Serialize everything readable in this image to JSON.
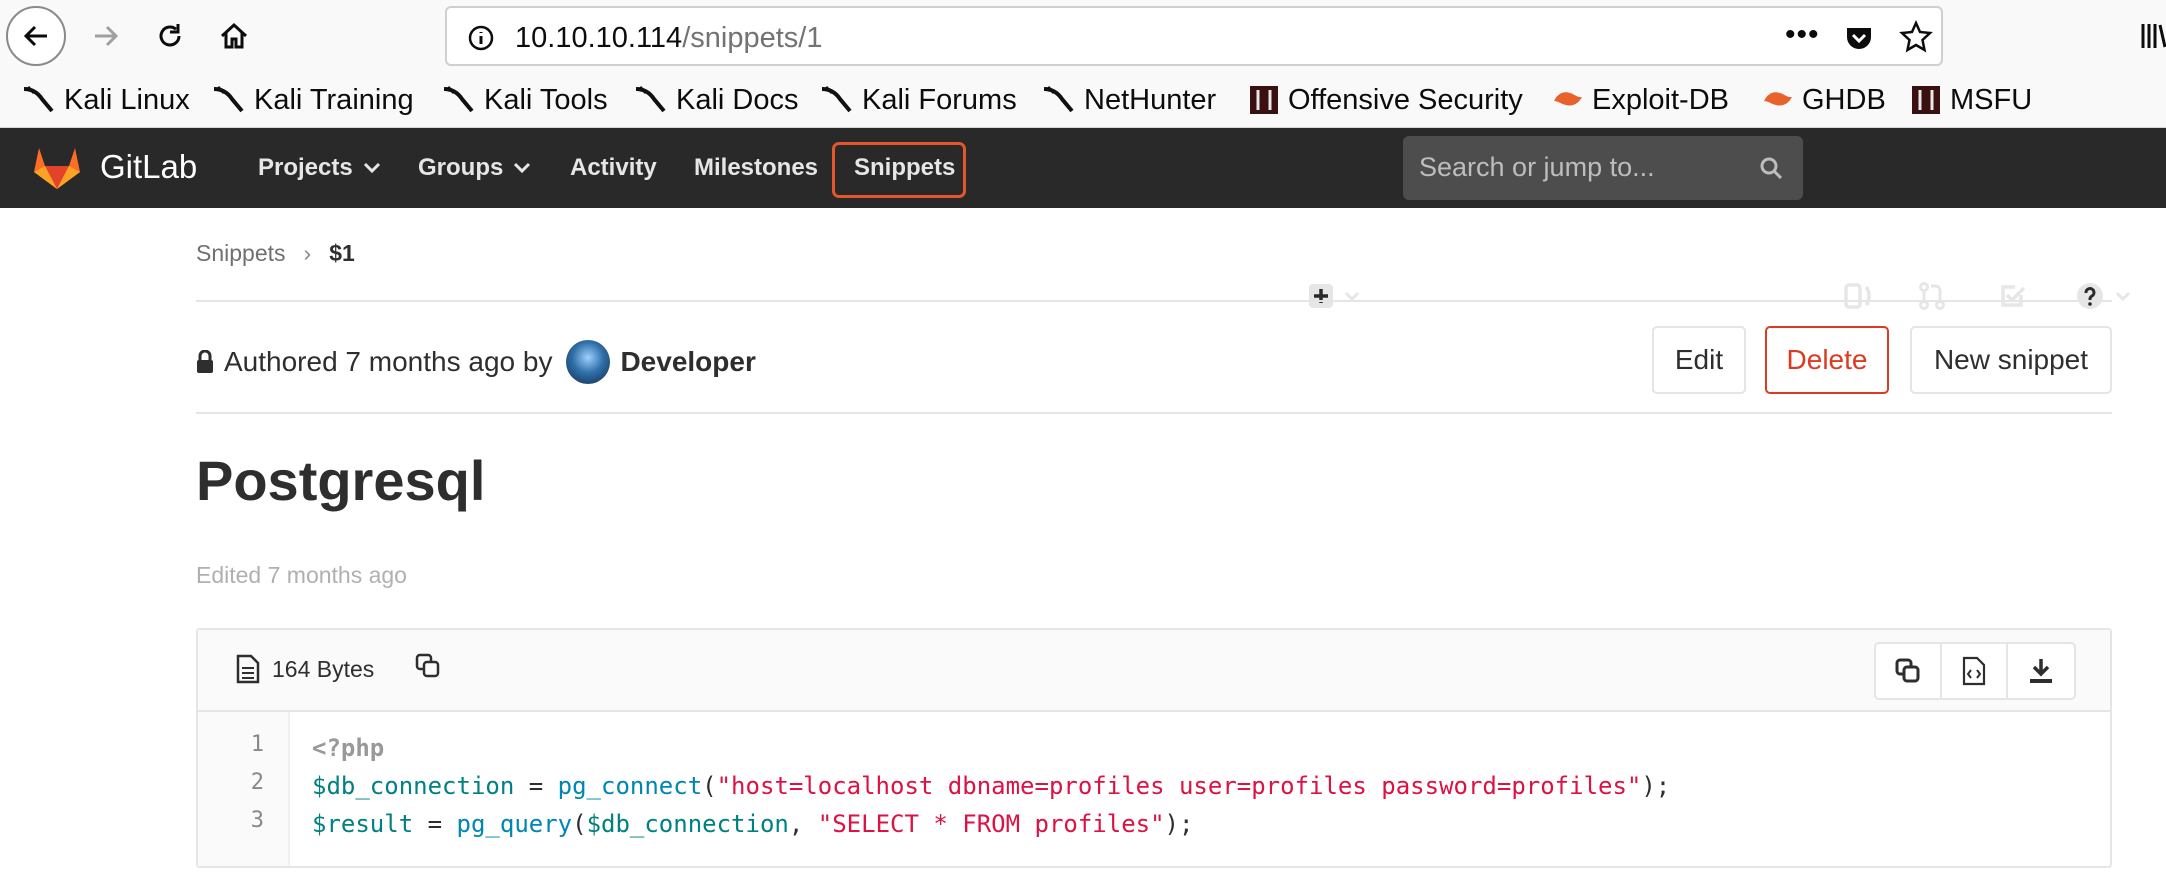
{
  "browser": {
    "url_host": "10.10.10.114",
    "url_path": "/snippets/1",
    "bookmarks": [
      "Kali Linux",
      "Kali Training",
      "Kali Tools",
      "Kali Docs",
      "Kali Forums",
      "NetHunter",
      "Offensive Security",
      "Exploit-DB",
      "GHDB",
      "MSFU"
    ]
  },
  "gitlab": {
    "brand": "GitLab",
    "nav": [
      "Projects",
      "Groups",
      "Activity",
      "Milestones",
      "Snippets"
    ],
    "search_placeholder": "Search or jump to..."
  },
  "breadcrumb": {
    "root": "Snippets",
    "current": "$1"
  },
  "snippet": {
    "authored_prefix": "Authored 7 months ago by",
    "author": "Developer",
    "buttons": {
      "edit": "Edit",
      "delete": "Delete",
      "new": "New snippet"
    },
    "title": "Postgresql",
    "edited": "Edited 7 months ago",
    "file_size": "164 Bytes",
    "line_numbers": [
      "1",
      "2",
      "3"
    ]
  },
  "code": {
    "line1": "<?php",
    "l2_var": "$db_connection",
    "l2_eq": " = ",
    "l2_fn": "pg_connect",
    "l2_open": "(",
    "l2_str": "\"host=localhost dbname=profiles user=profiles password=profiles\"",
    "l2_close": ");",
    "l3_var": "$result",
    "l3_eq": " = ",
    "l3_fn": "pg_query",
    "l3_open": "(",
    "l3_var2": "$db_connection",
    "l3_comma": ", ",
    "l3_str": "\"SELECT * FROM profiles\"",
    "l3_close": ");"
  },
  "colors": {
    "gitlab_header": "#292929",
    "accent_orange": "#e4562c",
    "delete_red": "#db3b21"
  }
}
